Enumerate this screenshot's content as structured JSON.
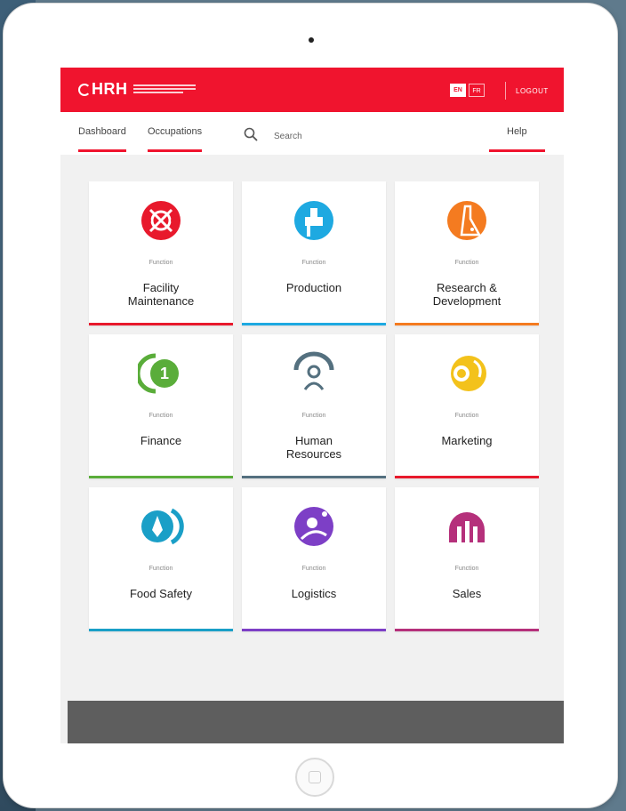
{
  "app": {
    "logo_text": "HRH"
  },
  "header": {
    "lang_en": "EN",
    "lang_fr": "FR",
    "logout": "LOGOUT"
  },
  "nav": {
    "dashboard": "Dashboard",
    "occupations": "Occupations",
    "search": "Search",
    "help": "Help"
  },
  "cards": [
    {
      "kicker": "Function",
      "title": "Facility\nMaintenance",
      "color": "#e8192c",
      "icon": "tools-gear-icon"
    },
    {
      "kicker": "Function",
      "title": "Production",
      "color": "#1ea9e1",
      "icon": "factory-icon"
    },
    {
      "kicker": "Function",
      "title": "Research &\nDevelopment",
      "color": "#f47b20",
      "icon": "flask-icon"
    },
    {
      "kicker": "Function",
      "title": "Finance",
      "color": "#5aad3a",
      "icon": "coin-icon"
    },
    {
      "kicker": "Function",
      "title": "Human\nResources",
      "color": "#54707f",
      "icon": "people-icon"
    },
    {
      "kicker": "Function",
      "title": "Marketing",
      "color": "#f3c21b",
      "icon": "megaphone-icon"
    },
    {
      "kicker": "Function",
      "title": "Food Safety",
      "color": "#1a9fc7",
      "icon": "leaf-drop-icon"
    },
    {
      "kicker": "Function",
      "title": "Logistics",
      "color": "#7d3fc6",
      "icon": "globe-icon"
    },
    {
      "kicker": "Function",
      "title": "Sales",
      "color": "#b5307b",
      "icon": "chart-bars-icon"
    }
  ]
}
